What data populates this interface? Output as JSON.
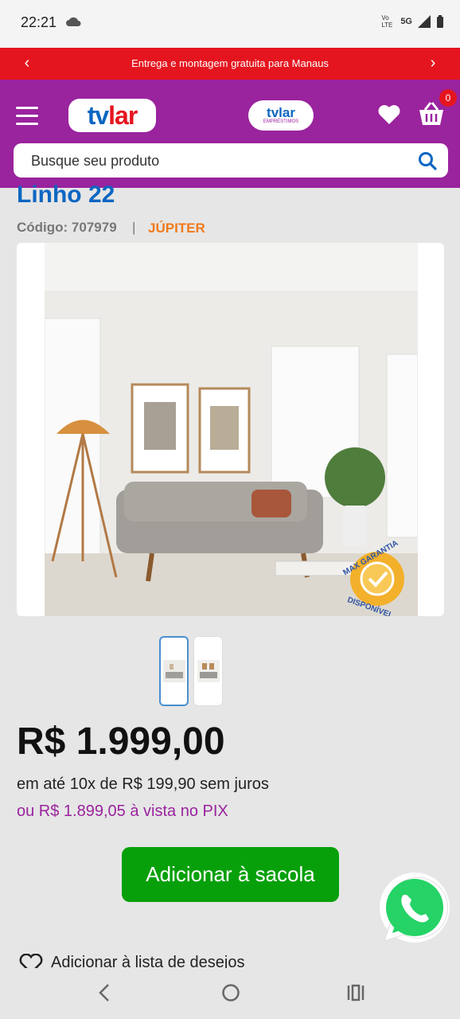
{
  "status": {
    "time": "22:21",
    "network": "5G",
    "lte": "Vo LTE"
  },
  "promo": {
    "text": "Entrega e montagem gratuita para Manaus",
    "prev": "‹",
    "next": "›"
  },
  "header": {
    "logo_a": "tv",
    "logo_b": "lar",
    "emp_a": "tvlar",
    "emp_b": "EMPRÉSTIMOS",
    "cart_count": "0"
  },
  "search": {
    "placeholder": "Busque seu produto"
  },
  "product": {
    "title": "Linho 22",
    "code": "Código: 707979",
    "separator": "|",
    "brand": "JÚPITER",
    "badge": [
      "MAX GARANTIA",
      "DISPONÍVEL"
    ],
    "price": "R$ 1.999,00",
    "installments": "em até 10x de R$ 199,90 sem juros",
    "pix": "ou R$ 1.899,05 à vista no PIX",
    "add_to_bag": "Adicionar à sacola",
    "wishlist": "Adicionar à lista de desejos"
  },
  "colors": {
    "brand_purple": "#9a239e",
    "promo_red": "#e5151f",
    "title_blue": "#0c66c2",
    "button_green": "#07a00b",
    "brand_orange": "#f07a1a"
  }
}
